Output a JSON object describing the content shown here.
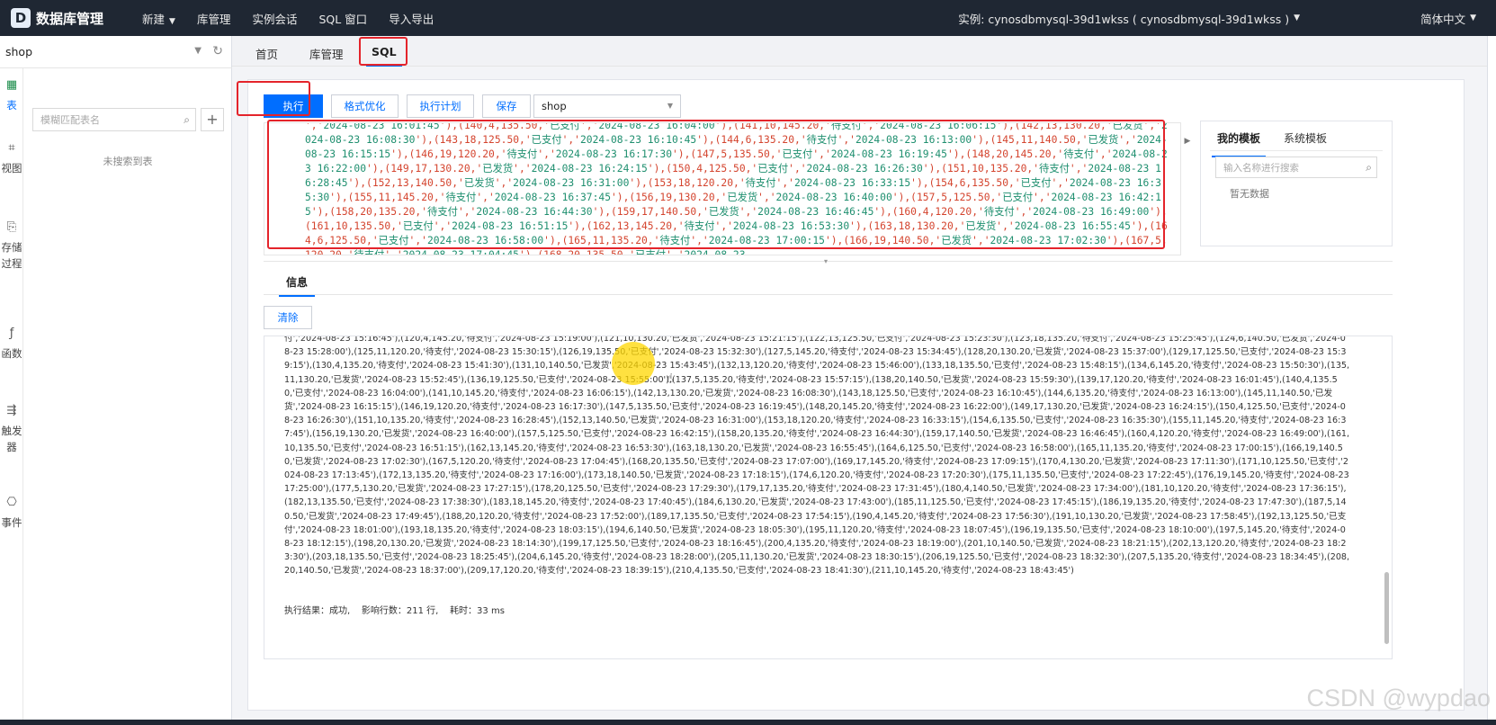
{
  "app": {
    "logo_letter": "D",
    "title": "数据库管理"
  },
  "topnav": {
    "items": [
      "新建",
      "库管理",
      "实例会话",
      "SQL 窗口",
      "导入导出"
    ],
    "instance": "实例: cynosdbmysql-39d1wkss ( cynosdbmysql-39d1wkss )",
    "language": "简体中文"
  },
  "sidebar": {
    "database": "shop",
    "vtabs": [
      "表",
      "视图",
      "存储过程",
      "函数",
      "触发器",
      "事件"
    ],
    "search_placeholder": "模糊匹配表名",
    "add": "+",
    "empty": "未搜索到表"
  },
  "page_tabs": [
    "首页",
    "库管理",
    "SQL"
  ],
  "toolbar": {
    "execute": "执行",
    "format": "格式优化",
    "plan": "执行计划",
    "save": "保存",
    "database": "shop"
  },
  "editor": {
    "code": "','2024-08-23 16:01:45'),(140,4,135.50,'已支付','2024-08-23 16:04:00'),(141,10,145.20,'待支付','2024-08-23 16:06:15'),(142,13,130.20,'已发货','2024-08-23 16:08:30'),(143,18,125.50,'已支付','2024-08-23 16:10:45'),(144,6,135.20,'待支付','2024-08-23 16:13:00'),(145,11,140.50,'已发货','2024-08-23 16:15:15'),(146,19,120.20,'待支付','2024-08-23 16:17:30'),(147,5,135.50,'已支付','2024-08-23 16:19:45'),(148,20,145.20,'待支付','2024-08-23 16:22:00'),(149,17,130.20,'已发货','2024-08-23 16:24:15'),(150,4,125.50,'已支付','2024-08-23 16:26:30'),(151,10,135.20,'待支付','2024-08-23 16:28:45'),(152,13,140.50,'已发货','2024-08-23 16:31:00'),(153,18,120.20,'待支付','2024-08-23 16:33:15'),(154,6,135.50,'已支付','2024-08-23 16:35:30'),(155,11,145.20,'待支付','2024-08-23 16:37:45'),(156,19,130.20,'已发货','2024-08-23 16:40:00'),(157,5,125.50,'已支付','2024-08-23 16:42:15'),(158,20,135.20,'待支付','2024-08-23 16:44:30'),(159,17,140.50,'已发货','2024-08-23 16:46:45'),(160,4,120.20,'待支付','2024-08-23 16:49:00'),(161,10,135.50,'已支付','2024-08-23 16:51:15'),(162,13,145.20,'待支付','2024-08-23 16:53:30'),(163,18,130.20,'已发货','2024-08-23 16:55:45'),(164,6,125.50,'已支付','2024-08-23 16:58:00'),(165,11,135.20,'待支付','2024-08-23 17:00:15'),(166,19,140.50,'已发货','2024-08-23 17:02:30'),(167,5,120.20,'待支付','2024-08-23 17:04:45'),(168,20,135.50,'已支付','2024-08-23"
  },
  "templates": {
    "tabs": [
      "我的模板",
      "系统模板"
    ],
    "search_placeholder": "输入名称进行搜索",
    "empty": "暂无数据"
  },
  "info": {
    "tab": "信息",
    "clear": "清除",
    "log": "付','2024-08-23 15:16:45'),(120,4,145.20,'待支付','2024-08-23 15:19:00'),(121,10,130.20,'已发货','2024-08-23 15:21:15'),(122,13,125.50,'已支付','2024-08-23 15:23:30'),(123,18,135.20,'待支付','2024-08-23 15:25:45'),(124,6,140.50,'已发货','2024-08-23 15:28:00'),(125,11,120.20,'待支付','2024-08-23 15:30:15'),(126,19,135.50,'已支付','2024-08-23 15:32:30'),(127,5,145.20,'待支付','2024-08-23 15:34:45'),(128,20,130.20,'已发货','2024-08-23 15:37:00'),(129,17,125.50,'已支付','2024-08-23 15:39:15'),(130,4,135.20,'待支付','2024-08-23 15:41:30'),(131,10,140.50,'已发货','2024-08-23 15:43:45'),(132,13,120.20,'待支付','2024-08-23 15:46:00'),(133,18,135.50,'已支付','2024-08-23 15:48:15'),(134,6,145.20,'待支付','2024-08-23 15:50:30'),(135,11,130.20,'已发货','2024-08-23 15:52:45'),(136,19,125.50,'已支付','2024-08-23 15:55:00'),(137,5,135.20,'待支付','2024-08-23 15:57:15'),(138,20,140.50,'已发货','2024-08-23 15:59:30'),(139,17,120.20,'待支付','2024-08-23 16:01:45'),(140,4,135.50,'已支付','2024-08-23 16:04:00'),(141,10,145.20,'待支付','2024-08-23 16:06:15'),(142,13,130.20,'已发货','2024-08-23 16:08:30'),(143,18,125.50,'已支付','2024-08-23 16:10:45'),(144,6,135.20,'待支付','2024-08-23 16:13:00'),(145,11,140.50,'已发货','2024-08-23 16:15:15'),(146,19,120.20,'待支付','2024-08-23 16:17:30'),(147,5,135.50,'已支付','2024-08-23 16:19:45'),(148,20,145.20,'待支付','2024-08-23 16:22:00'),(149,17,130.20,'已发货','2024-08-23 16:24:15'),(150,4,125.50,'已支付','2024-08-23 16:26:30'),(151,10,135.20,'待支付','2024-08-23 16:28:45'),(152,13,140.50,'已发货','2024-08-23 16:31:00'),(153,18,120.20,'待支付','2024-08-23 16:33:15'),(154,6,135.50,'已支付','2024-08-23 16:35:30'),(155,11,145.20,'待支付','2024-08-23 16:37:45'),(156,19,130.20,'已发货','2024-08-23 16:40:00'),(157,5,125.50,'已支付','2024-08-23 16:42:15'),(158,20,135.20,'待支付','2024-08-23 16:44:30'),(159,17,140.50,'已发货','2024-08-23 16:46:45'),(160,4,120.20,'待支付','2024-08-23 16:49:00'),(161,10,135.50,'已支付','2024-08-23 16:51:15'),(162,13,145.20,'待支付','2024-08-23 16:53:30'),(163,18,130.20,'已发货','2024-08-23 16:55:45'),(164,6,125.50,'已支付','2024-08-23 16:58:00'),(165,11,135.20,'待支付','2024-08-23 17:00:15'),(166,19,140.50,'已发货','2024-08-23 17:02:30'),(167,5,120.20,'待支付','2024-08-23 17:04:45'),(168,20,135.50,'已支付','2024-08-23 17:07:00'),(169,17,145.20,'待支付','2024-08-23 17:09:15'),(170,4,130.20,'已发货','2024-08-23 17:11:30'),(171,10,125.50,'已支付','2024-08-23 17:13:45'),(172,13,135.20,'待支付','2024-08-23 17:16:00'),(173,18,140.50,'已发货','2024-08-23 17:18:15'),(174,6,120.20,'待支付','2024-08-23 17:20:30'),(175,11,135.50,'已支付','2024-08-23 17:22:45'),(176,19,145.20,'待支付','2024-08-23 17:25:00'),(177,5,130.20,'已发货','2024-08-23 17:27:15'),(178,20,125.50,'已支付','2024-08-23 17:29:30'),(179,17,135.20,'待支付','2024-08-23 17:31:45'),(180,4,140.50,'已发货','2024-08-23 17:34:00'),(181,10,120.20,'待支付','2024-08-23 17:36:15'),(182,13,135.50,'已支付','2024-08-23 17:38:30'),(183,18,145.20,'待支付','2024-08-23 17:40:45'),(184,6,130.20,'已发货','2024-08-23 17:43:00'),(185,11,125.50,'已支付','2024-08-23 17:45:15'),(186,19,135.20,'待支付','2024-08-23 17:47:30'),(187,5,140.50,'已发货','2024-08-23 17:49:45'),(188,20,120.20,'待支付','2024-08-23 17:52:00'),(189,17,135.50,'已支付','2024-08-23 17:54:15'),(190,4,145.20,'待支付','2024-08-23 17:56:30'),(191,10,130.20,'已发货','2024-08-23 17:58:45'),(192,13,125.50,'已支付','2024-08-23 18:01:00'),(193,18,135.20,'待支付','2024-08-23 18:03:15'),(194,6,140.50,'已发货','2024-08-23 18:05:30'),(195,11,120.20,'待支付','2024-08-23 18:07:45'),(196,19,135.50,'已支付','2024-08-23 18:10:00'),(197,5,145.20,'待支付','2024-08-23 18:12:15'),(198,20,130.20,'已发货','2024-08-23 18:14:30'),(199,17,125.50,'已支付','2024-08-23 18:16:45'),(200,4,135.20,'待支付','2024-08-23 18:19:00'),(201,10,140.50,'已发货','2024-08-23 18:21:15'),(202,13,120.20,'待支付','2024-08-23 18:23:30'),(203,18,135.50,'已支付','2024-08-23 18:25:45'),(204,6,145.20,'待支付','2024-08-23 18:28:00'),(205,11,130.20,'已发货','2024-08-23 18:30:15'),(206,19,125.50,'已支付','2024-08-23 18:32:30'),(207,5,135.20,'待支付','2024-08-23 18:34:45'),(208,20,140.50,'已发货','2024-08-23 18:37:00'),(209,17,120.20,'待支付','2024-08-23 18:39:15'),(210,4,135.50,'已支付','2024-08-23 18:41:30'),(211,10,145.20,'待支付','2024-08-23 18:43:45')",
    "summary": "执行结果：成功,    影响行数：211 行,    耗时：33 ms"
  },
  "watermark": "CSDN @wypdao",
  "colors": {
    "accent": "#006eff",
    "highlight": "#e4242b",
    "topbar": "#1f2733",
    "code_number": "#1f8f6f",
    "code_string": "#d4442e"
  }
}
